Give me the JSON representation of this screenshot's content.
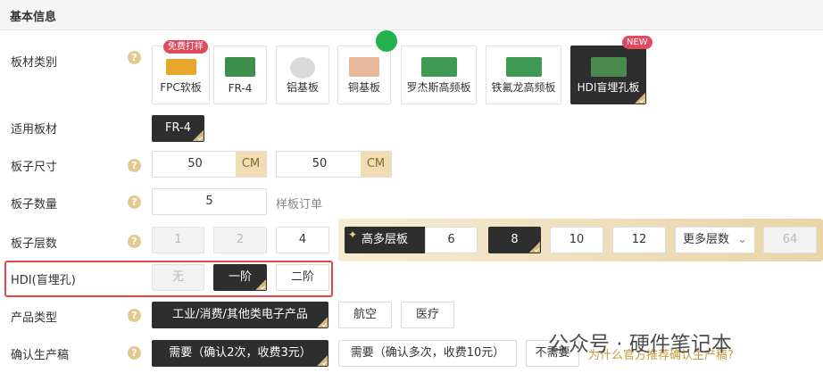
{
  "section_title": "基本信息",
  "labels": {
    "material_type": "板材类别",
    "applicable_board": "适用板材",
    "board_size": "板子尺寸",
    "board_qty": "板子数量",
    "layers": "板子层数",
    "hdi": "HDI(盲埋孔)",
    "product_type": "产品类型",
    "confirm_prod": "确认生产稿"
  },
  "materials": [
    {
      "label": "FPC软板",
      "tag": "免费打样"
    },
    {
      "label": "FR-4",
      "tag": ""
    },
    {
      "label": "铝基板",
      "tag": ""
    },
    {
      "label": "铜基板",
      "tag": ""
    },
    {
      "label": "罗杰斯高频板",
      "tag": ""
    },
    {
      "label": "铁氟龙高频板",
      "tag": ""
    },
    {
      "label": "HDI盲埋孔板",
      "tag": "NEW"
    }
  ],
  "selected_material": "HDI盲埋孔板",
  "applicable": "FR-4",
  "size": {
    "width": "50",
    "height": "50",
    "unit": "CM"
  },
  "quantity": {
    "value": "5",
    "hint": "样板订单"
  },
  "layer_options": [
    "1",
    "2",
    "4"
  ],
  "high_layers_label": "高多层板",
  "high_layer_options": [
    "6",
    "8",
    "10",
    "12"
  ],
  "selected_layer": "8",
  "more_layers_label": "更多层数",
  "layer_64": "64",
  "hdi_options": [
    "无",
    "一阶",
    "二阶"
  ],
  "selected_hdi": "一阶",
  "product_types": [
    "工业/消费/其他类电子产品",
    "航空",
    "医疗"
  ],
  "confirm_options": [
    "需要（确认2次，收费3元）",
    "需要（确认多次，收费10元）",
    "不需要"
  ],
  "why_link": "为什么官方推荐确认生产稿?",
  "watermark": "公众号 · 硬件笔记本",
  "help_glyph": "?",
  "colors": {
    "selected_bg": "#2e2e2e",
    "accent_gold": "#d4b77c",
    "highlight_red": "#e64545"
  }
}
